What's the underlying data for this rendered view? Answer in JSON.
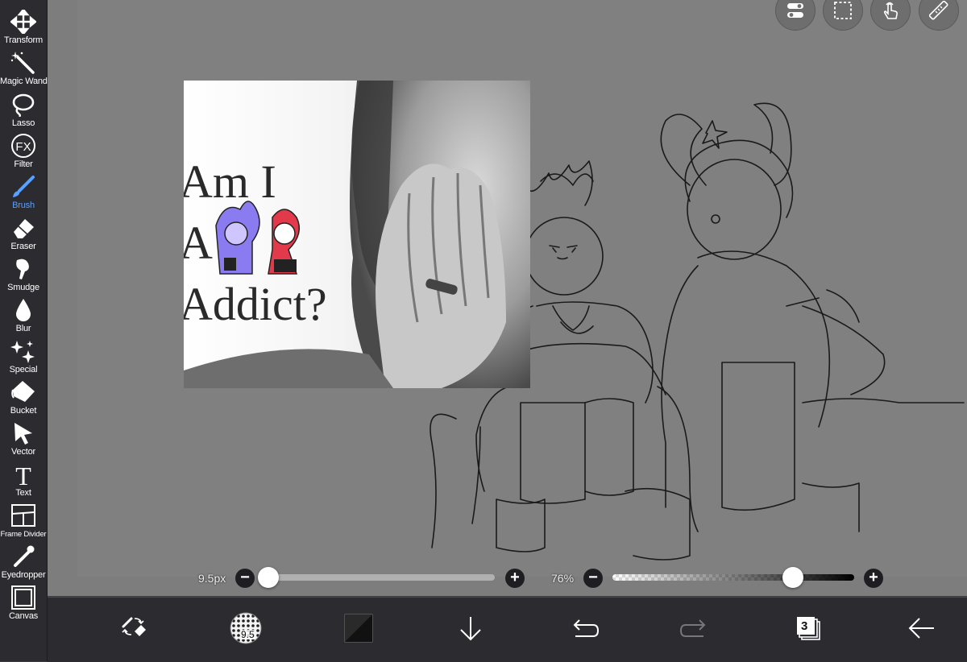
{
  "sidebar": {
    "tools": [
      {
        "id": "transform",
        "label": "Transform",
        "icon": "transform-icon"
      },
      {
        "id": "magic-wand",
        "label": "Magic Wand",
        "icon": "magic-wand-icon"
      },
      {
        "id": "lasso",
        "label": "Lasso",
        "icon": "lasso-icon"
      },
      {
        "id": "filter",
        "label": "Filter",
        "icon": "fx-icon"
      },
      {
        "id": "brush",
        "label": "Brush",
        "icon": "brush-icon",
        "active": true
      },
      {
        "id": "eraser",
        "label": "Eraser",
        "icon": "eraser-icon"
      },
      {
        "id": "smudge",
        "label": "Smudge",
        "icon": "smudge-icon"
      },
      {
        "id": "blur",
        "label": "Blur",
        "icon": "blur-drop-icon"
      },
      {
        "id": "special",
        "label": "Special",
        "icon": "sparkle-icon"
      },
      {
        "id": "bucket",
        "label": "Bucket",
        "icon": "bucket-icon"
      },
      {
        "id": "vector",
        "label": "Vector",
        "icon": "cursor-arrow-icon"
      },
      {
        "id": "text",
        "label": "Text",
        "icon": "text-icon"
      },
      {
        "id": "frame-divider",
        "label": "Frame Divider",
        "icon": "frame-divider-icon"
      },
      {
        "id": "eyedropper",
        "label": "Eyedropper",
        "icon": "eyedropper-icon"
      },
      {
        "id": "canvas",
        "label": "Canvas",
        "icon": "canvas-icon"
      }
    ]
  },
  "top_buttons": [
    "toggle-icon",
    "selection-marquee-icon",
    "touch-hand-icon",
    "ruler-icon"
  ],
  "image": {
    "line1": "Am I",
    "line2": "A",
    "line3": "Addict?"
  },
  "sliders": {
    "brush_size": {
      "label": "9.5px",
      "fraction": 0.0
    },
    "opacity": {
      "label": "76%",
      "fraction": 0.76
    }
  },
  "bottom_bar": {
    "brush_size_badge": "9.5",
    "layer_count": "3"
  },
  "colors": {
    "active_tool": "#5aa0ff",
    "canvas_bg": "#808080",
    "chrome": "#2b2b30"
  }
}
